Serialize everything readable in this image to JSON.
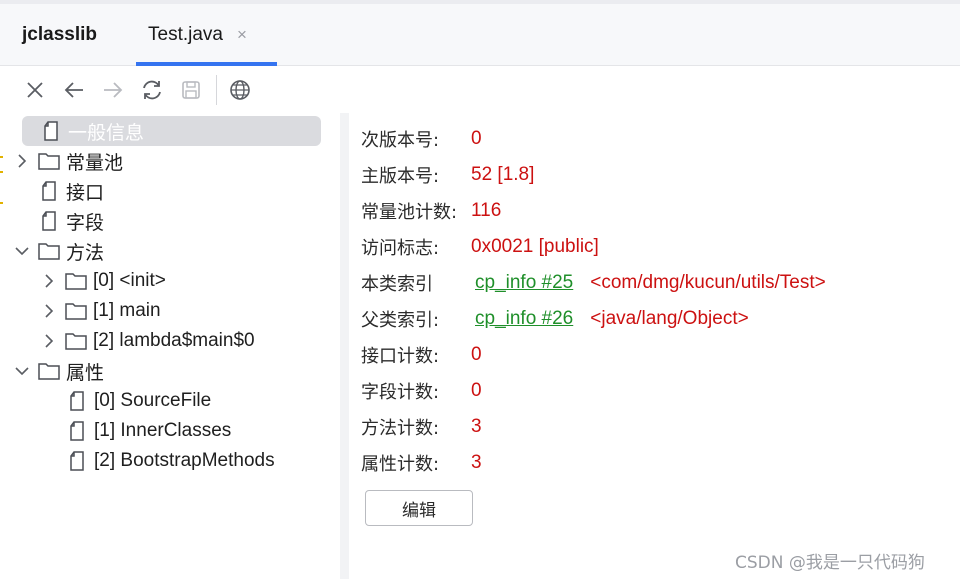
{
  "tabs": {
    "app_title": "jclasslib",
    "file_tab": "Test.java",
    "close_glyph": "×"
  },
  "toolbar": {
    "icons": [
      "close-icon",
      "back-arrow-icon",
      "forward-arrow-icon",
      "refresh-icon",
      "save-icon",
      "globe-icon"
    ]
  },
  "tree": {
    "items": [
      {
        "label": "一般信息",
        "icon": "file-icon",
        "expandable": false,
        "selected": true
      },
      {
        "label": "常量池",
        "icon": "folder-icon",
        "expandable": true,
        "expanded": false
      },
      {
        "label": "接口",
        "icon": "file-icon",
        "expandable": false
      },
      {
        "label": "字段",
        "icon": "file-icon",
        "expandable": false
      },
      {
        "label": "方法",
        "icon": "folder-icon",
        "expandable": true,
        "expanded": true
      },
      {
        "label": "[0] <init>",
        "icon": "folder-icon",
        "expandable": true,
        "expanded": false
      },
      {
        "label": "[1] main",
        "icon": "folder-icon",
        "expandable": true,
        "expanded": false
      },
      {
        "label": "[2] lambda$main$0",
        "icon": "folder-icon",
        "expandable": true,
        "expanded": false
      },
      {
        "label": "属性",
        "icon": "folder-icon",
        "expandable": true,
        "expanded": true
      },
      {
        "label": "[0] SourceFile",
        "icon": "file-icon",
        "expandable": false
      },
      {
        "label": "[1] InnerClasses",
        "icon": "file-icon",
        "expandable": false
      },
      {
        "label": "[2] BootstrapMethods",
        "icon": "file-icon",
        "expandable": false
      }
    ]
  },
  "info": {
    "minor_version": {
      "label": "次版本号:",
      "value": "0"
    },
    "major_version": {
      "label": "主版本号:",
      "value": "52 [1.8]"
    },
    "constant_pool_count": {
      "label": "常量池计数:",
      "value": "116"
    },
    "access_flags": {
      "label": "访问标志:",
      "value": "0x0021 [public]"
    },
    "this_class": {
      "label": "本类索引",
      "link": "cp_info #25",
      "ref": "<com/dmg/kucun/utils/Test>"
    },
    "super_class": {
      "label": "父类索引:",
      "link": "cp_info #26",
      "ref": "<java/lang/Object>"
    },
    "interfaces_count": {
      "label": "接口计数:",
      "value": "0"
    },
    "fields_count": {
      "label": "字段计数:",
      "value": "0"
    },
    "methods_count": {
      "label": "方法计数:",
      "value": "3"
    },
    "attributes_count": {
      "label": "属性计数:",
      "value": "3"
    },
    "edit_button": "编辑"
  },
  "watermark": "CSDN @我是一只代码狗",
  "colors": {
    "value_red": "#cc1111",
    "link_green": "#1f8f2a",
    "tab_accent": "#3574f0",
    "selection_bg": "#dadbdf"
  }
}
